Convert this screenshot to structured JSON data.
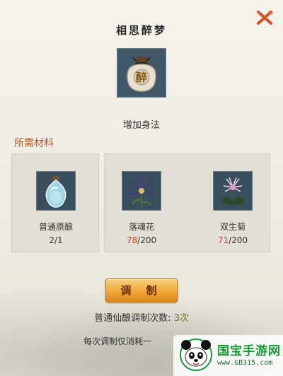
{
  "dialog": {
    "title": "相思醉梦",
    "main_item": {
      "icon": "wine-jar-icon",
      "icon_glyph": "醉",
      "description": "增加身法"
    },
    "materials_label": "所需材料",
    "materials": [
      {
        "name": "普通原酿",
        "have": "2",
        "need": "1",
        "have_color": "#333333",
        "icon": "crystal-bottle-icon"
      },
      {
        "name": "落魂花",
        "have": "78",
        "need": "200",
        "have_color": "#d0402a",
        "icon": "purple-flower-icon"
      },
      {
        "name": "双生菊",
        "have": "71",
        "need": "200",
        "have_color": "#d0402a",
        "icon": "chrysanthemum-icon"
      }
    ],
    "craft_button_label": "调 制",
    "brew_count_label": "普通仙酿调制次数:",
    "brew_count_value": "3次",
    "consume_text": "每次调制仅消耗一"
  },
  "watermark": {
    "text": "国宝手游网",
    "url": "www.GB315.com"
  },
  "colors": {
    "accent": "#c0541f",
    "close": "#d2502a",
    "button": "#f0a634",
    "insufficient": "#d0402a",
    "count": "#6a7d20"
  }
}
